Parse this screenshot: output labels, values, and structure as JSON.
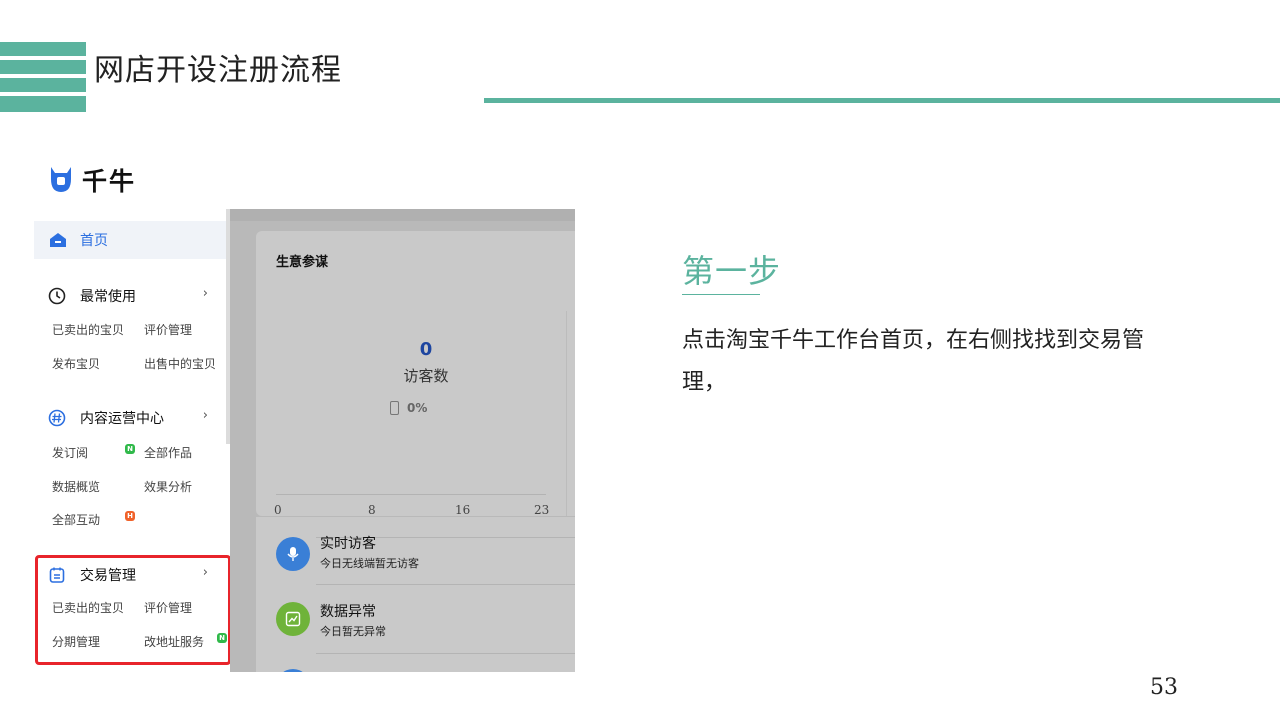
{
  "slide": {
    "title": "网店开设注册流程",
    "accent_color": "#5bb39e",
    "page_number": "53"
  },
  "step": {
    "title": "第一步",
    "description": "点击淘宝千牛工作台首页，在右侧找找到交易管理，"
  },
  "app": {
    "logo_text": "千牛",
    "logo_icon": "qianniu-logo-icon",
    "sidebar": {
      "home": {
        "label": "首页",
        "icon": "home-icon"
      },
      "sections": [
        {
          "label": "最常使用",
          "icon": "clock-icon",
          "items": [
            "已卖出的宝贝",
            "评价管理",
            "发布宝贝",
            "出售中的宝贝"
          ]
        },
        {
          "label": "内容运营中心",
          "icon": "hashtag-icon",
          "items": [
            "发订阅",
            "全部作品",
            "数据概览",
            "效果分析",
            "全部互动"
          ],
          "badges": [
            "N",
            "H"
          ]
        },
        {
          "label": "交易管理",
          "icon": "clipboard-icon",
          "items": [
            "已卖出的宝贝",
            "评价管理",
            "分期管理",
            "改地址服务"
          ],
          "badges": [
            "N"
          ],
          "highlight_color": "#e8242b"
        }
      ]
    },
    "main": {
      "card_title": "生意参谋",
      "visitor_value": "0",
      "visitor_label": "访客数",
      "mobile_pct": "0%",
      "axis_ticks": [
        "0",
        "8",
        "16",
        "23"
      ],
      "list": [
        {
          "title": "实时访客",
          "subtitle": "今日无线端暂无访客",
          "icon": "microphone-icon",
          "color": "#3a7fd6"
        },
        {
          "title": "数据异常",
          "subtitle": "今日暂无异常",
          "icon": "chart-line-icon",
          "color": "#6fb33a"
        }
      ]
    }
  }
}
